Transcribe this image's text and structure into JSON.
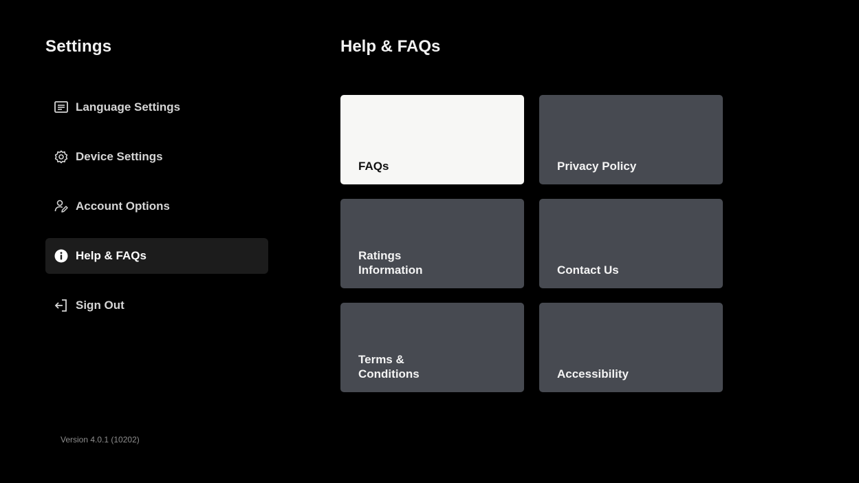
{
  "sidebar": {
    "title": "Settings",
    "items": [
      {
        "label": "Language Settings",
        "icon": "subtitles-icon",
        "active": false
      },
      {
        "label": "Device Settings",
        "icon": "gear-icon",
        "active": false
      },
      {
        "label": "Account Options",
        "icon": "user-edit-icon",
        "active": false
      },
      {
        "label": "Help & FAQs",
        "icon": "info-icon",
        "active": true
      },
      {
        "label": "Sign Out",
        "icon": "sign-out-icon",
        "active": false
      }
    ],
    "version": "Version 4.0.1 (10202)"
  },
  "main": {
    "title": "Help & FAQs",
    "tiles": [
      {
        "label": "FAQs",
        "selected": true
      },
      {
        "label": "Privacy Policy",
        "selected": false
      },
      {
        "label": "Ratings\nInformation",
        "selected": false
      },
      {
        "label": "Contact Us",
        "selected": false
      },
      {
        "label": "Terms &\nConditions",
        "selected": false
      },
      {
        "label": "Accessibility",
        "selected": false
      }
    ]
  },
  "colors": {
    "background": "#000000",
    "tile": "#474a51",
    "tile_selected": "#f7f7f5",
    "menu_active": "#1c1c1c",
    "version_text": "#8e8e8e"
  }
}
